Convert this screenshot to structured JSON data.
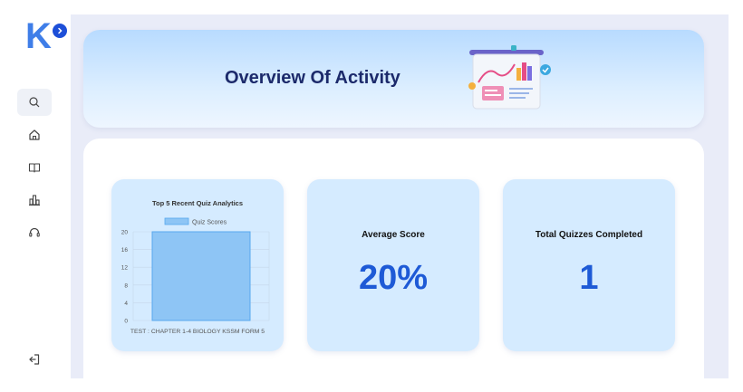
{
  "app": {
    "logo_letter": "K"
  },
  "sidebar": {
    "items": [
      {
        "id": "search",
        "icon": "search-icon"
      },
      {
        "id": "home",
        "icon": "home-icon"
      },
      {
        "id": "book",
        "icon": "book-icon"
      },
      {
        "id": "chart",
        "icon": "chart-icon"
      },
      {
        "id": "support",
        "icon": "headset-icon"
      },
      {
        "id": "logout",
        "icon": "logout-icon"
      }
    ]
  },
  "header": {
    "title": "Overview Of Activity"
  },
  "stats": {
    "average_score_label": "Average Score",
    "average_score_value": "20%",
    "total_quizzes_label": "Total Quizzes Completed",
    "total_quizzes_value": "1"
  },
  "colors": {
    "accent": "#1e5ad6",
    "card_bg": "#d5ebff",
    "bar_fill": "#8ec5f5",
    "bar_stroke": "#58a8ee"
  },
  "chart_data": {
    "type": "bar",
    "title": "Top 5 Recent Quiz Analytics",
    "categories": [
      "TEST : CHAPTER 1-4 BIOLOGY KSSM FORM 5"
    ],
    "series": [
      {
        "name": "Quiz Scores",
        "values": [
          20
        ]
      }
    ],
    "yticks": [
      0,
      4,
      8,
      12,
      16,
      20
    ],
    "ylim": [
      0,
      20
    ],
    "grid": true,
    "legend": "top"
  }
}
